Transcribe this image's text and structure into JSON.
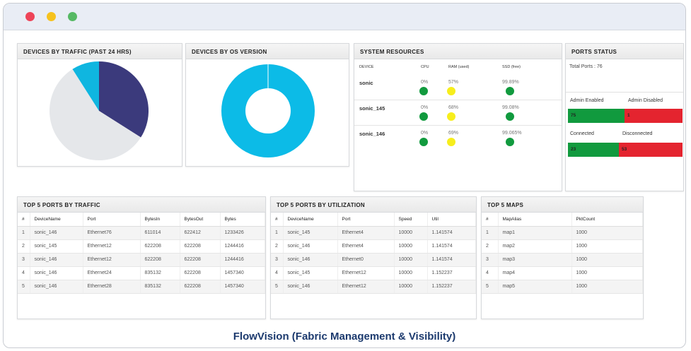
{
  "window": {
    "controls": [
      "close",
      "minimize",
      "maximize"
    ]
  },
  "caption": "FlowVision (Fabric Management & Visibility)",
  "traffic_panel": {
    "title": "DEVICES BY TRAFFIC (PAST 24 HRS)",
    "chart_data": {
      "type": "pie",
      "slices": [
        {
          "value": 34,
          "color": "#3b3a7c"
        },
        {
          "value": 57,
          "color": "#e5e7ea"
        },
        {
          "value": 9,
          "color": "#0fb6e0"
        }
      ]
    }
  },
  "os_panel": {
    "title": "DEVICES BY OS VERSION",
    "chart_data": {
      "type": "pie",
      "donut": true,
      "slices": [
        {
          "value": 100,
          "color": "#0cbbe7"
        }
      ]
    }
  },
  "resources": {
    "title": "SYSTEM RESOURCES",
    "headers": {
      "device": "DEVICE",
      "cpu": "CPU",
      "ram": "RAM (used)",
      "ssd": "SSD (free)"
    },
    "rows": [
      {
        "device": "sonic",
        "cpu": "0%",
        "ram": "57%",
        "ssd": "99.89%",
        "cpu_color": "#119a3e",
        "ram_color": "#f7ee1c",
        "ssd_color": "#119a3e"
      },
      {
        "device": "sonic_145",
        "cpu": "0%",
        "ram": "68%",
        "ssd": "99.08%",
        "cpu_color": "#119a3e",
        "ram_color": "#f7ee1c",
        "ssd_color": "#119a3e"
      },
      {
        "device": "sonic_146",
        "cpu": "0%",
        "ram": "69%",
        "ssd": "99.065%",
        "cpu_color": "#119a3e",
        "ram_color": "#f7ee1c",
        "ssd_color": "#119a3e"
      }
    ]
  },
  "ports_status": {
    "title": "PORTS STATUS",
    "total": "Total Ports : 76",
    "admin_enabled_label": "Admin Enabled",
    "admin_disabled_label": "Admin Disabled",
    "admin_enabled_value": "75",
    "admin_disabled_value": "1",
    "connected_label": "Connected",
    "disconnected_label": "Disconnected",
    "connected_value": "23",
    "disconnected_value": "53",
    "green": "#119a3e",
    "red": "#e4242f"
  },
  "ports_traffic": {
    "title": "TOP 5 PORTS BY TRAFFIC",
    "headers": [
      "#",
      "DeviceName",
      "Port",
      "BytesIn",
      "BytesOut",
      "Bytes"
    ],
    "rows": [
      [
        "1",
        "sonic_146",
        "Ethernet76",
        "611014",
        "622412",
        "1233426"
      ],
      [
        "2",
        "sonic_145",
        "Ethernet12",
        "622208",
        "622208",
        "1244416"
      ],
      [
        "3",
        "sonic_146",
        "Ethernet12",
        "622208",
        "622208",
        "1244416"
      ],
      [
        "4",
        "sonic_146",
        "Ethernet24",
        "835132",
        "622208",
        "1457340"
      ],
      [
        "5",
        "sonic_146",
        "Ethernet28",
        "835132",
        "622208",
        "1457340"
      ]
    ]
  },
  "ports_util": {
    "title": "TOP 5 PORTS BY UTILIZATION",
    "headers": [
      "#",
      "DeviceName",
      "Port",
      "Speed",
      "Util"
    ],
    "rows": [
      [
        "1",
        "sonic_145",
        "Ethernet4",
        "10000",
        "1.141574"
      ],
      [
        "2",
        "sonic_146",
        "Ethernet4",
        "10000",
        "1.141574"
      ],
      [
        "3",
        "sonic_146",
        "Ethernet0",
        "10000",
        "1.141574"
      ],
      [
        "4",
        "sonic_145",
        "Ethernet12",
        "10000",
        "1.152237"
      ],
      [
        "5",
        "sonic_146",
        "Ethernet12",
        "10000",
        "1.152237"
      ]
    ]
  },
  "maps": {
    "title": "TOP 5 MAPS",
    "headers": [
      "#",
      "MapAlias",
      "PktCount"
    ],
    "rows": [
      [
        "1",
        "map1",
        "1000"
      ],
      [
        "2",
        "map2",
        "1000"
      ],
      [
        "3",
        "map3",
        "1000"
      ],
      [
        "4",
        "map4",
        "1000"
      ],
      [
        "5",
        "map5",
        "1000"
      ]
    ]
  }
}
